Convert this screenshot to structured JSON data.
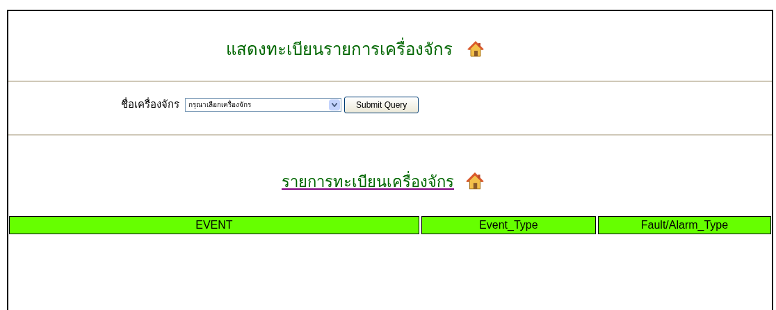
{
  "title": "แสดงทะเบียนรายการเครื่องจักร",
  "form": {
    "label": "ชื่อเครื่องจักร",
    "select_value": "กรุณาเลือกเครื่องจักร",
    "submit": "Submit Query"
  },
  "subtitle": "รายการทะเบียนเครื่องจักร",
  "table": {
    "columns": [
      "EVENT",
      "Event_Type",
      "Fault/Alarm_Type"
    ]
  }
}
